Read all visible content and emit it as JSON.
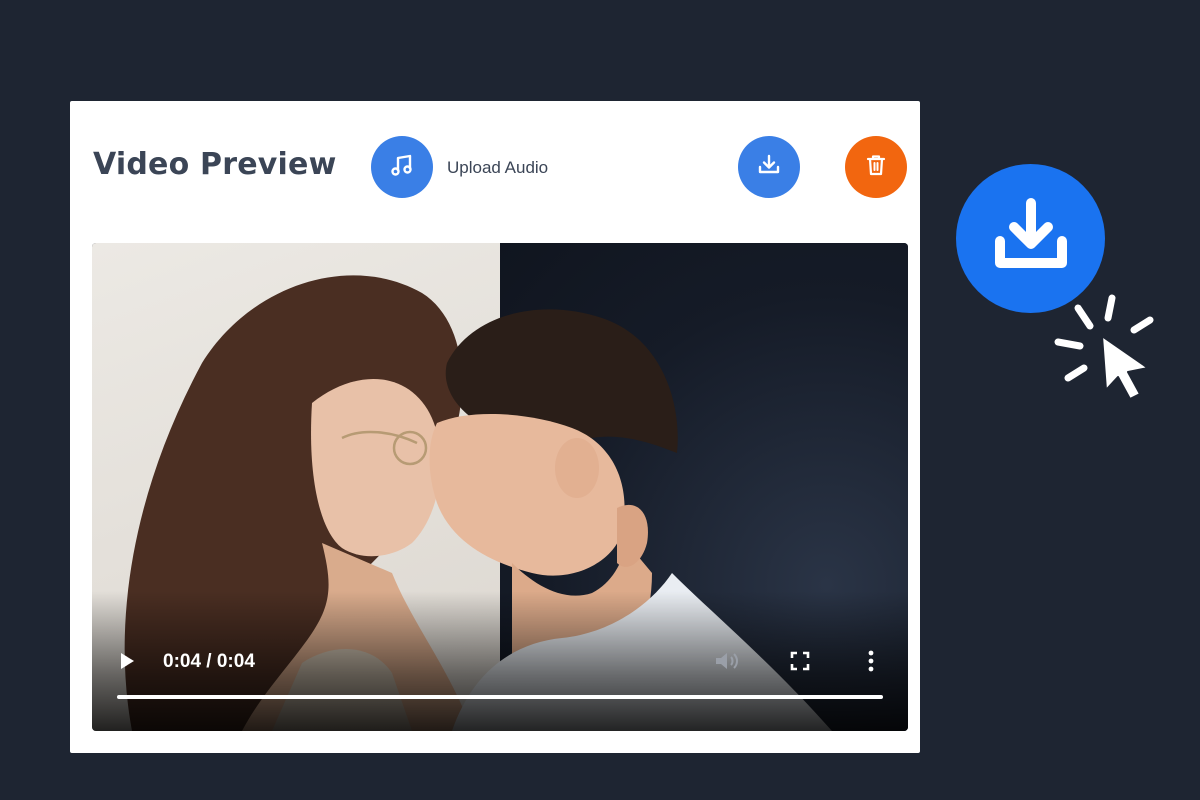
{
  "panel": {
    "title": "Video Preview",
    "upload_audio_label": "Upload Audio"
  },
  "icons": {
    "upload_audio": "music-note-icon",
    "download": "download-icon",
    "delete": "trash-icon",
    "play": "play-icon",
    "mute": "volume-icon",
    "fullscreen": "fullscreen-icon",
    "more": "more-vertical-icon",
    "cursor": "mouse-pointer-icon"
  },
  "player": {
    "time": "0:04 / 0:04",
    "progress": 1.0
  },
  "colors": {
    "background": "#1e2532",
    "primary_blue": "#3a7fe6",
    "highlight_blue": "#1a73f0",
    "delete_orange": "#f2660f"
  }
}
